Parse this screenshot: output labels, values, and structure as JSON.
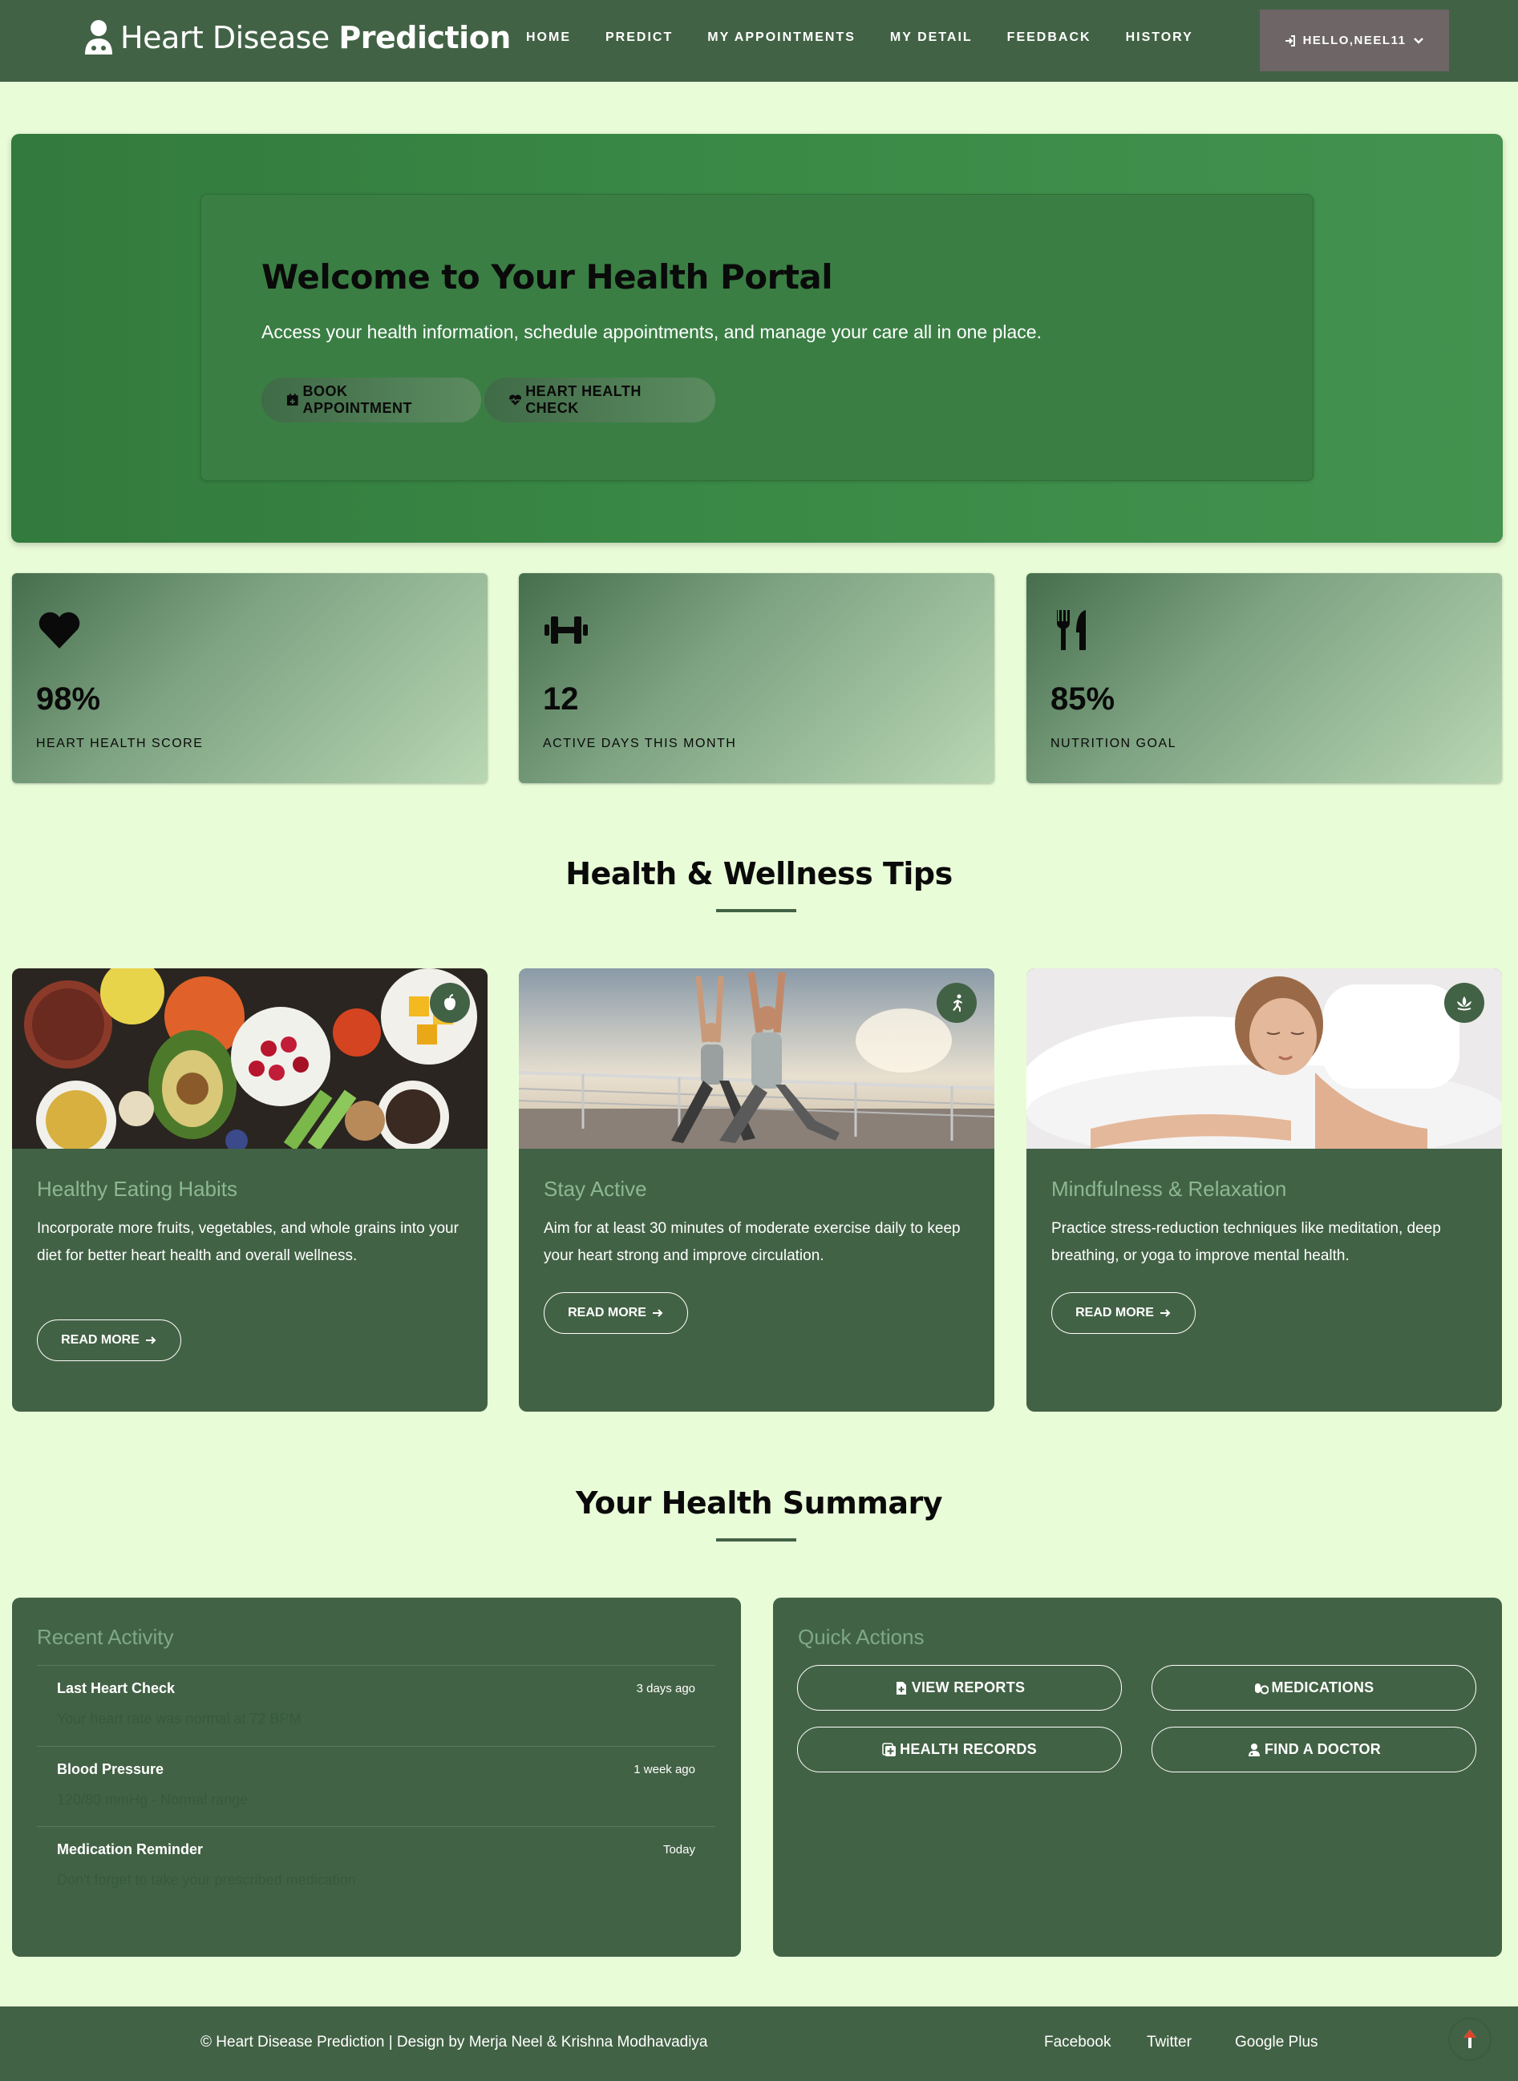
{
  "navbar": {
    "brand_light": "Heart Disease ",
    "brand_bold": "Prediction",
    "brand_icon": "doctor-icon",
    "menu": [
      "HOME",
      "PREDICT",
      "MY APPOINTMENTS",
      "MY DETAIL",
      "FEEDBACK",
      "HISTORY"
    ],
    "user_label": "HELLO,NEEL11"
  },
  "hero": {
    "title": "Welcome to Your Health Portal",
    "subtitle": "Access your health information, schedule appointments, and manage your care all in one place.",
    "btn_book": "BOOK APPOINTMENT",
    "btn_check": "HEART HEALTH CHECK"
  },
  "stats": [
    {
      "icon": "heart-icon",
      "value": "98%",
      "label": "HEART HEALTH SCORE"
    },
    {
      "icon": "dumbbell-icon",
      "value": "12",
      "label": "ACTIVE DAYS THIS MONTH"
    },
    {
      "icon": "utensils-icon",
      "value": "85%",
      "label": "NUTRITION GOAL"
    }
  ],
  "tips_section": {
    "title": "Health & Wellness Tips"
  },
  "tips": [
    {
      "icon": "apple-icon",
      "title": "Healthy Eating Habits",
      "text": "Incorporate more fruits, vegetables, and whole grains into your diet for better heart health and overall wellness.",
      "cta": "READ MORE"
    },
    {
      "icon": "running-icon",
      "title": "Stay Active",
      "text": "Aim for at least 30 minutes of moderate exercise daily to keep your heart strong and improve circulation.",
      "cta": "READ MORE"
    },
    {
      "icon": "lotus-icon",
      "title": "Mindfulness & Relaxation",
      "text": "Practice stress-reduction techniques like meditation, deep breathing, or yoga to improve mental health.",
      "cta": "READ MORE"
    }
  ],
  "summary_section": {
    "title": "Your Health Summary"
  },
  "recent_activity": {
    "title": "Recent Activity",
    "items": [
      {
        "name": "Last Heart Check",
        "time": "3 days ago",
        "desc": "Your heart rate was normal at 72 BPM"
      },
      {
        "name": "Blood Pressure",
        "time": "1 week ago",
        "desc": "120/80 mmHg - Normal range"
      },
      {
        "name": "Medication Reminder",
        "time": "Today",
        "desc": "Don't forget to take your prescribed medication"
      }
    ]
  },
  "quick_actions": {
    "title": "Quick Actions",
    "buttons": [
      {
        "icon": "file-medical-icon",
        "label": "VIEW REPORTS"
      },
      {
        "icon": "pills-icon",
        "label": "MEDICATIONS"
      },
      {
        "icon": "notes-medical-icon",
        "label": "HEALTH RECORDS"
      },
      {
        "icon": "user-doctor-icon",
        "label": "FIND A DOCTOR"
      }
    ]
  },
  "footer": {
    "copyright": "© Heart Disease Prediction | Design by Merja Neel & Krishna Modhavadiya",
    "links": [
      "Facebook",
      "Twitter",
      "Google Plus"
    ]
  },
  "colors": {
    "nav": "#426245",
    "page_bg": "#e9fcd8",
    "hero": "#3a8a46",
    "tip_title": "#8cb891"
  }
}
